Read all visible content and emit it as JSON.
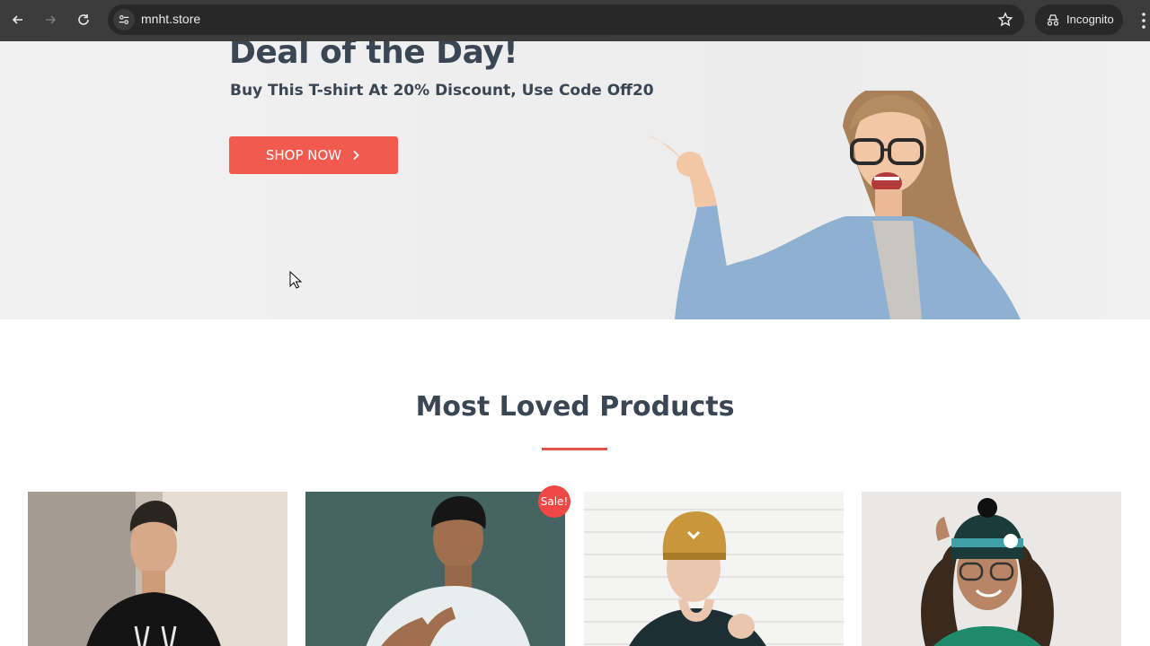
{
  "browser": {
    "url": "mnht.store",
    "incognito_label": "Incognito"
  },
  "hero": {
    "title": "Deal of the Day!",
    "subtitle": "Buy This T-shirt At 20% Discount, Use Code Off20",
    "cta_label": "SHOP NOW"
  },
  "section": {
    "title": "Most Loved Products"
  },
  "products": [
    {
      "badge": ""
    },
    {
      "badge": "Sale!"
    },
    {
      "badge": ""
    },
    {
      "badge": ""
    }
  ],
  "colors": {
    "accent": "#f25a4f",
    "heading": "#3a4653",
    "chrome": "#3c3c3c"
  },
  "icons": [
    "back-arrow-icon",
    "forward-arrow-icon",
    "reload-icon",
    "site-settings-icon",
    "star-icon",
    "incognito-icon",
    "menu-dots-icon",
    "chevron-right-icon",
    "mouse-cursor-icon"
  ]
}
